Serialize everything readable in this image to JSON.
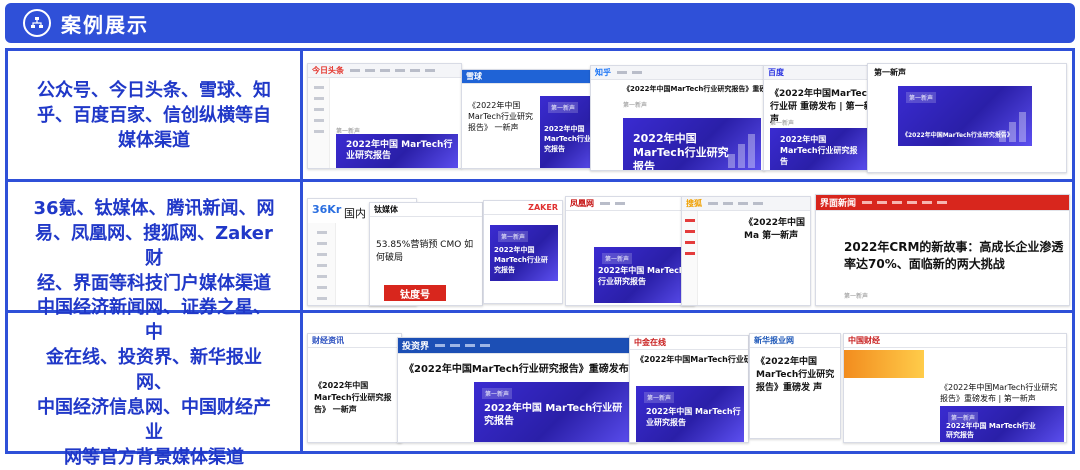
{
  "header": {
    "title": "案例展示",
    "icon": "sitemap-icon"
  },
  "colors": {
    "brand_blue": "#2f50d8",
    "label_blue": "#2038c8",
    "cover_purple": "#3a2bd1",
    "jiemian_red": "#d8261d"
  },
  "rows": [
    {
      "label": "公众号、今日头条、雪球、知乎、百度百家、信创纵横等自媒体渠道",
      "label_lines": [
        "公众号、今日头条、雪球、知",
        "乎、百度百家、信创纵横等自",
        "媒体渠道"
      ],
      "shots": [
        {
          "logo": "今日头条",
          "title": "",
          "author": "第一新声",
          "cover": "2022年中国 MarTech行业研究报告"
        },
        {
          "logo": "雪球",
          "title": "《2022年中国MarTech行业研究报告》 一新声",
          "author": "第一新声",
          "cover": "2022年中国 MarTech行业研究报告"
        },
        {
          "logo": "知乎",
          "title": "《2022年中国MarTech行业研究报告》重磅发布 | 第一新声",
          "author": "第一新声",
          "cover": "2022年中国 MarTech行业研究报告"
        },
        {
          "logo": "百度",
          "title": "《2022年中国MarTech行业研 重磅发布 | 第一新声",
          "author": "第一新声",
          "cover": "2022年中国 MarTech行业研究报告"
        },
        {
          "logo": "",
          "title": "第一新声",
          "author": "第一新声",
          "cover": "《2022年中国MarTech行业研究报告》"
        }
      ]
    },
    {
      "label": "36氪、钛媒体、腾讯新闻、网易、凤凰网、搜狐网、Zaker财经、界面等科技门户媒体渠道",
      "label_lines": [
        "36氪、钛媒体、腾讯新闻、网",
        "易、凤凰网、搜狐网、Zaker财",
        "经、界面等科技门户媒体渠道"
      ],
      "shots": [
        {
          "logo": "36Kr",
          "title": "国内",
          "author": "",
          "cover": ""
        },
        {
          "logo": "钛媒体",
          "title": "53.85%营销预 CMO 如何破局",
          "author": "钛度号",
          "cover": ""
        },
        {
          "logo": "ZAKER",
          "title": "",
          "author": "第一新声",
          "cover": "2022年中国 MarTech行业研究报告"
        },
        {
          "logo": "凤凰网",
          "title": "",
          "author": "第一新声",
          "cover": "2022年中国 MarTech行业研究报告"
        },
        {
          "logo": "搜狐",
          "title": "《2022年中国Ma 第一新声",
          "author": "第一新声",
          "cover": ""
        },
        {
          "logo": "界面新闻",
          "title": "2022年CRM的新故事：高成长企业渗透率达70%、面临新的两大挑战",
          "author": "第一新声",
          "cover": ""
        }
      ]
    },
    {
      "label": "中国经济新闻网、证券之星、中金在线、投资界、新华报业网、中国经济信息网、中国财经产业网等官方背景媒体渠道",
      "label_lines": [
        "中国经济新闻网、证券之星、中",
        "金在线、投资界、新华报业网、",
        "中国经济信息网、中国财经产业",
        "网等官方背景媒体渠道"
      ],
      "shots": [
        {
          "logo": "财经资讯",
          "title": "《2022年中国MarTech行业研究报告》 一新声",
          "author": "",
          "cover": ""
        },
        {
          "logo": "投资界",
          "title": "《2022年中国MarTech行业研究报告》重磅发布 |",
          "author": "第一新声",
          "cover": "2022年中国 MarTech行业研究报告"
        },
        {
          "logo": "中金在线",
          "title": "《2022年中国MarTech行业研究报告",
          "author": "第一新声",
          "cover": "2022年中国 MarTech行业研究报告"
        },
        {
          "logo": "新华报业网",
          "title": "《2022年中国MarTech行业研究报告》重磅发 声",
          "author": "",
          "cover": ""
        },
        {
          "logo": "中国财经",
          "title": "《2022年中国MarTech行业研究报告》重磅发布 | 第一新声",
          "author": "第一新声",
          "cover": "2022年中国 MarTech行业研究报告"
        }
      ]
    }
  ]
}
